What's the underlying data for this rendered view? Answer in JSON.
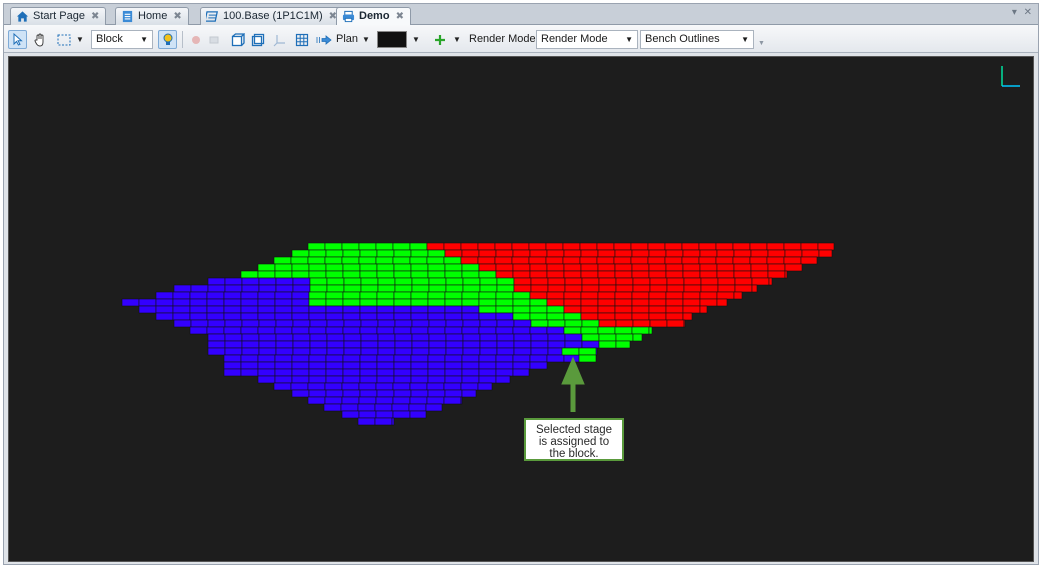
{
  "tabs": [
    {
      "label": "Start Page",
      "icon": "home-icon",
      "active": false
    },
    {
      "label": "Home",
      "icon": "document-icon",
      "active": false
    },
    {
      "label": "100.Base (1P1C1M)",
      "icon": "database-icon",
      "active": false
    },
    {
      "label": "Demo",
      "icon": "printer-view-icon",
      "active": true
    }
  ],
  "window_controls": "▾ ✕",
  "toolbar": {
    "selection_mode": "Block",
    "view_direction": "Plan",
    "render_mode_label": "Render Mode",
    "render_mode_value": "Render Mode",
    "outline_mode": "Bench Outlines"
  },
  "colors": {
    "stage_red": "#ff0000",
    "stage_green": "#00ff00",
    "stage_blue": "#3300ff",
    "viewport_bg": "#1d1d1d",
    "annotation_green": "#5a9a3c",
    "block_outline": "#111111"
  },
  "annotation": {
    "lines": [
      "Selected stage",
      "is assigned to",
      "the block."
    ]
  }
}
